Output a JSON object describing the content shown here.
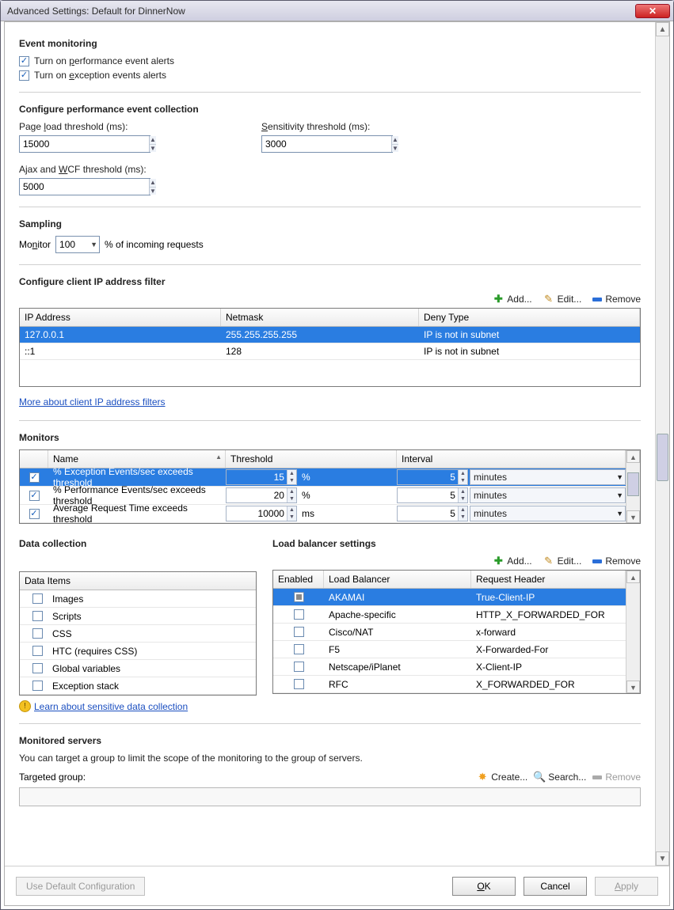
{
  "window": {
    "title": "Advanced Settings: Default for DinnerNow"
  },
  "event_monitoring": {
    "heading": "Event monitoring",
    "perf_alerts_label": "Turn on performance event alerts",
    "perf_alerts_checked": true,
    "exc_alerts_label": "Turn on exception events alerts",
    "exc_alerts_checked": true
  },
  "perf_collection": {
    "heading": "Configure performance event collection",
    "page_load_label": "Page load threshold (ms):",
    "page_load_value": "15000",
    "sensitivity_label": "Sensitivity threshold (ms):",
    "sensitivity_value": "3000",
    "ajax_label": "Ajax and WCF threshold (ms):",
    "ajax_value": "5000"
  },
  "sampling": {
    "heading": "Sampling",
    "monitor_label": "Monitor",
    "percent_value": "100",
    "suffix_label": "% of incoming requests"
  },
  "ip_filter": {
    "heading": "Configure client IP address filter",
    "add_label": "Add...",
    "edit_label": "Edit...",
    "remove_label": "Remove",
    "col_ip": "IP Address",
    "col_netmask": "Netmask",
    "col_deny": "Deny Type",
    "rows": [
      {
        "ip": "127.0.0.1",
        "netmask": "255.255.255.255",
        "deny": "IP is not in subnet",
        "selected": true
      },
      {
        "ip": "::1",
        "netmask": "128",
        "deny": "IP is not in subnet",
        "selected": false
      }
    ],
    "more_link": "More about client IP address filters"
  },
  "monitors": {
    "heading": "Monitors",
    "col_name": "Name",
    "col_threshold": "Threshold",
    "col_interval": "Interval",
    "rows": [
      {
        "checked": true,
        "name": "% Exception Events/sec exceeds threshold",
        "threshold": "15",
        "unit": "%",
        "interval": "5",
        "interval_unit": "minutes",
        "selected": true
      },
      {
        "checked": true,
        "name": "% Performance Events/sec exceeds threshold",
        "threshold": "20",
        "unit": "%",
        "interval": "5",
        "interval_unit": "minutes",
        "selected": false
      },
      {
        "checked": true,
        "name": "Average Request Time exceeds threshold",
        "threshold": "10000",
        "unit": "ms",
        "interval": "5",
        "interval_unit": "minutes",
        "selected": false
      }
    ]
  },
  "data_collection": {
    "heading": "Data collection",
    "col_data_items": "Data Items",
    "items": [
      {
        "checked": false,
        "label": "Images"
      },
      {
        "checked": false,
        "label": "Scripts"
      },
      {
        "checked": false,
        "label": "CSS"
      },
      {
        "checked": false,
        "label": "HTC (requires CSS)"
      },
      {
        "checked": false,
        "label": "Global variables"
      },
      {
        "checked": false,
        "label": "Exception stack"
      }
    ],
    "learn_link": "Learn about sensitive data collection"
  },
  "load_balancer": {
    "heading": "Load balancer settings",
    "add_label": "Add...",
    "edit_label": "Edit...",
    "remove_label": "Remove",
    "col_enabled": "Enabled",
    "col_lb": "Load Balancer",
    "col_header": "Request Header",
    "rows": [
      {
        "enabled": false,
        "name": "AKAMAI",
        "header": "True-Client-IP",
        "selected": true
      },
      {
        "enabled": false,
        "name": "Apache-specific",
        "header": "HTTP_X_FORWARDED_FOR",
        "selected": false
      },
      {
        "enabled": false,
        "name": "Cisco/NAT",
        "header": "x-forward",
        "selected": false
      },
      {
        "enabled": false,
        "name": "F5",
        "header": "X-Forwarded-For",
        "selected": false
      },
      {
        "enabled": false,
        "name": "Netscape/iPlanet",
        "header": "X-Client-IP",
        "selected": false
      },
      {
        "enabled": false,
        "name": "RFC",
        "header": "X_FORWARDED_FOR",
        "selected": false
      }
    ]
  },
  "monitored_servers": {
    "heading": "Monitored servers",
    "message": "You can target a group to limit the scope of the monitoring to the group of servers.",
    "targeted_label": "Targeted group:",
    "create_label": "Create...",
    "search_label": "Search...",
    "remove_label": "Remove"
  },
  "footer": {
    "use_default": "Use Default Configuration",
    "ok": "OK",
    "cancel": "Cancel",
    "apply": "Apply"
  }
}
